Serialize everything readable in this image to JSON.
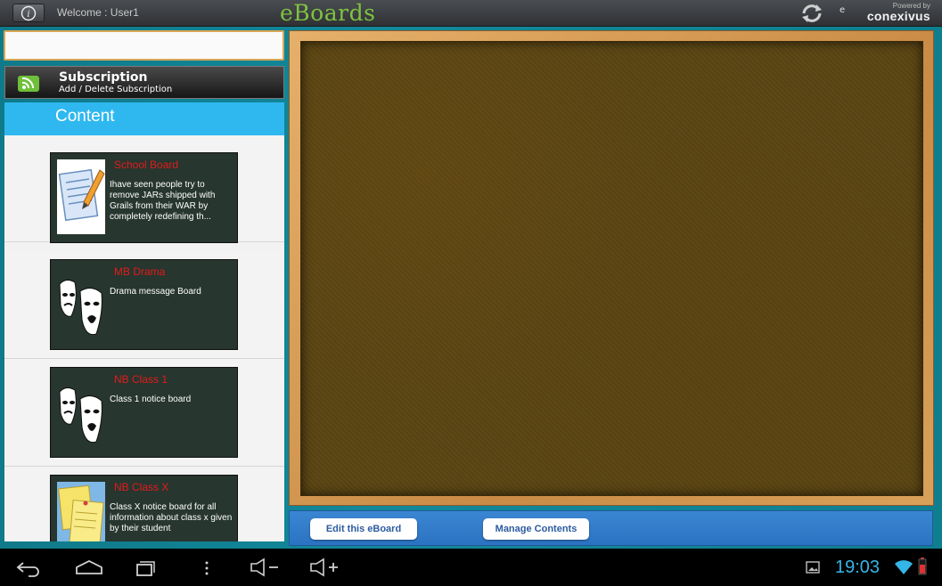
{
  "header": {
    "welcome": "Welcome : User1",
    "title": "eBoards",
    "powered_by": "Powered by",
    "brand": "conexivus",
    "brand_prefix": "e",
    "icons": [
      "info-icon",
      "sync-icon"
    ]
  },
  "sidebar": {
    "search_placeholder": "",
    "subscription": {
      "title": "Subscription",
      "description": "Add / Delete Subscription",
      "icon": "rss-icon"
    },
    "content_header": "Content",
    "items": [
      {
        "title": "School Board",
        "description": "Ihave seen people try to remove JARs shipped with Grails from their WAR by completely redefining th...",
        "icon": "notepad-pencil-icon"
      },
      {
        "title": "MB Drama",
        "description": "Drama message Board",
        "icon": "drama-masks-icon"
      },
      {
        "title": "NB Class 1",
        "description": "Class 1 notice board",
        "icon": "drama-masks-icon"
      },
      {
        "title": "NB Class X",
        "description": "Class X notice board for all information about class x given by their student",
        "icon": "sticky-notes-icon"
      }
    ]
  },
  "actions": {
    "edit_label": "Edit this eBoard",
    "manage_label": "Manage Contents"
  },
  "system": {
    "time": "19:03",
    "icons": [
      "back-icon",
      "home-icon",
      "recent-apps-icon",
      "menu-icon",
      "volume-down-icon",
      "volume-up-icon",
      "gallery-icon",
      "wifi-icon",
      "battery-icon"
    ]
  },
  "colors": {
    "accent": "#2fb8f0",
    "title_green": "#7fc241",
    "card_title": "#e21b1b",
    "action_bar": "#2b73c2",
    "time": "#35b6e8"
  }
}
